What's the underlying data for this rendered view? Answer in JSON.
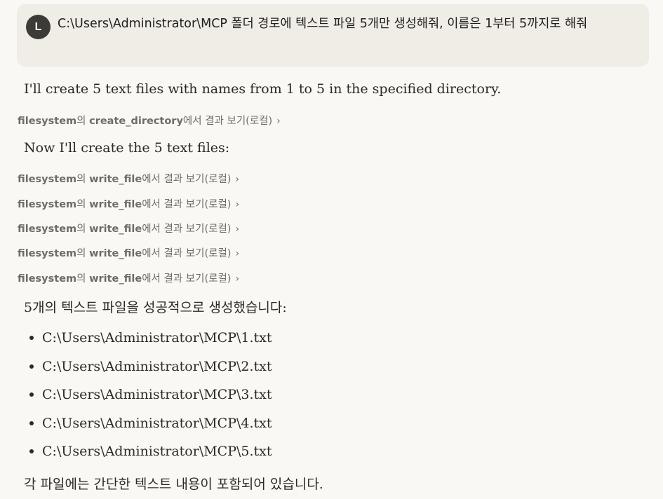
{
  "user_message": {
    "avatar_initial": "L",
    "text": "C:\\Users\\Administrator\\MCP 폴더 경로에 텍스트 파일 5개만 생성해줘, 이름은 1부터 5까지로 해줘"
  },
  "assistant": {
    "intro": "I'll create 5 text files with names from 1 to 5 in the specified directory.",
    "tool_calls_1": [
      {
        "server": "filesystem",
        "particle": "의 ",
        "tool": "create_directory",
        "suffix": "에서 결과 보기(로컬)",
        "icon": "chevron-right-icon"
      }
    ],
    "middle": "Now I'll create the 5 text files:",
    "tool_calls_2": [
      {
        "server": "filesystem",
        "particle": "의 ",
        "tool": "write_file",
        "suffix": "에서 결과 보기(로컬)",
        "icon": "chevron-right-icon"
      },
      {
        "server": "filesystem",
        "particle": "의 ",
        "tool": "write_file",
        "suffix": "에서 결과 보기(로컬)",
        "icon": "chevron-right-icon"
      },
      {
        "server": "filesystem",
        "particle": "의 ",
        "tool": "write_file",
        "suffix": "에서 결과 보기(로컬)",
        "icon": "chevron-right-icon"
      },
      {
        "server": "filesystem",
        "particle": "의 ",
        "tool": "write_file",
        "suffix": "에서 결과 보기(로컬)",
        "icon": "chevron-right-icon"
      },
      {
        "server": "filesystem",
        "particle": "의 ",
        "tool": "write_file",
        "suffix": "에서 결과 보기(로컬)",
        "icon": "chevron-right-icon"
      }
    ],
    "summary": "5개의 텍스트 파일을 성공적으로 생성했습니다:",
    "files": [
      "C:\\Users\\Administrator\\MCP\\1.txt",
      "C:\\Users\\Administrator\\MCP\\2.txt",
      "C:\\Users\\Administrator\\MCP\\3.txt",
      "C:\\Users\\Administrator\\MCP\\4.txt",
      "C:\\Users\\Administrator\\MCP\\5.txt"
    ],
    "closing": "각 파일에는 간단한 텍스트 내용이 포함되어 있습니다."
  }
}
